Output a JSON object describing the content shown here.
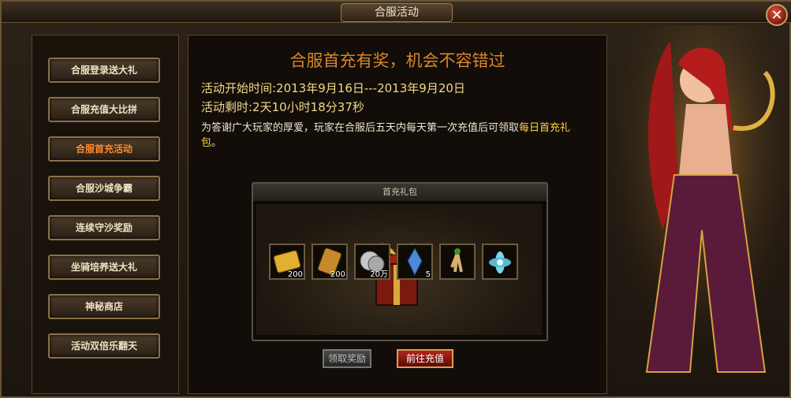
{
  "window": {
    "title": "合服活动"
  },
  "menu": {
    "items": [
      {
        "label": "合服登录送大礼",
        "active": false
      },
      {
        "label": "合服充值大比拼",
        "active": false
      },
      {
        "label": "合服首充活动",
        "active": true
      },
      {
        "label": "合服沙城争霸",
        "active": false
      },
      {
        "label": "连续守沙奖励",
        "active": false
      },
      {
        "label": "坐骑培养送大礼",
        "active": false
      },
      {
        "label": "神秘商店",
        "active": false
      },
      {
        "label": "活动双倍乐翻天",
        "active": false
      }
    ]
  },
  "content": {
    "headline": "合服首充有奖，机会不容错过",
    "start_time": "活动开始时间:2013年9月16日---2013年9月20日",
    "remaining": "活动剩时:2天10小时18分37秒",
    "desc_prefix": "为答谢广大玩家的厚爱，玩家在合服后五天内每天第一次充值后可领取",
    "desc_highlight": "每日首充礼包",
    "desc_suffix": "。"
  },
  "gift": {
    "title": "首充礼包",
    "items": [
      {
        "icon": "gold-ticket-icon",
        "qty": "200"
      },
      {
        "icon": "scroll-icon",
        "qty": "200"
      },
      {
        "icon": "silver-coins-icon",
        "qty": "20万"
      },
      {
        "icon": "crystal-shard-icon",
        "qty": "5"
      },
      {
        "icon": "ginseng-root-icon",
        "qty": ""
      },
      {
        "icon": "lotus-flower-icon",
        "qty": ""
      }
    ]
  },
  "buttons": {
    "claim": "领取奖励",
    "charge": "前往充值"
  },
  "colors": {
    "accent": "#d9862a",
    "active_menu": "#ff8a2a",
    "highlight": "#ffd34a"
  }
}
